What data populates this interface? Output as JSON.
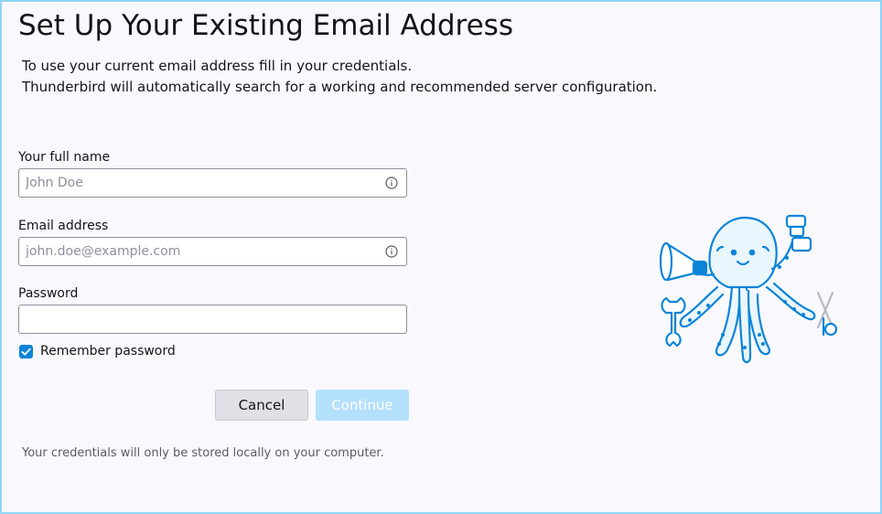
{
  "page": {
    "title": "Set Up Your Existing Email Address",
    "intro_line1": "To use your current email address fill in your credentials.",
    "intro_line2": "Thunderbird will automatically search for a working and recommended server configuration."
  },
  "form": {
    "full_name": {
      "label": "Your full name",
      "placeholder": "John Doe",
      "value": ""
    },
    "email": {
      "label": "Email address",
      "placeholder": "john.doe@example.com",
      "value": ""
    },
    "password": {
      "label": "Password",
      "placeholder": "",
      "value": ""
    },
    "remember_password": {
      "label": "Remember password",
      "checked": true
    }
  },
  "buttons": {
    "cancel_label": "Cancel",
    "continue_label": "Continue",
    "continue_disabled": true
  },
  "footnote": "Your credentials will only be stored locally on your computer.",
  "icons": {
    "info": "info-icon",
    "checkmark": "checkmark-icon",
    "mascot": "octopus-mascot"
  },
  "colors": {
    "accent": "#0b84d8",
    "continue_disabled_bg": "#b3e0fc",
    "frame_border": "#8fd4f4"
  }
}
